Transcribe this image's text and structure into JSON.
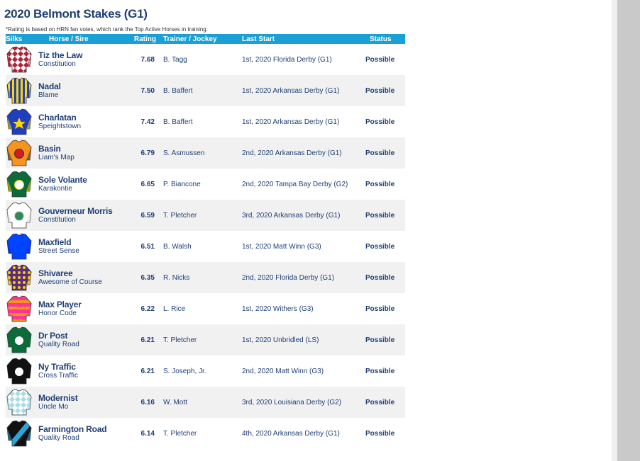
{
  "page": {
    "title": "2020 Belmont Stakes (G1)",
    "footnote": "*Rating is based on HRN fan votes, which rank the Top Active Horses in training."
  },
  "table": {
    "headers": [
      "Silks",
      "Horse / Sire",
      "Rating",
      "Trainer / Jockey",
      "Last Start",
      "Status"
    ],
    "rows": [
      {
        "horse": "Tiz the Law",
        "sire": "Constitution",
        "rating": "7.68",
        "trainer": "B. Tagg",
        "last_start": "1st, 2020 Florida Derby (G1)",
        "status": "Possible",
        "silk": {
          "pattern": "diamonds",
          "base": "#ffffff",
          "accent": "#b22234",
          "trim": "#b22234"
        }
      },
      {
        "horse": "Nadal",
        "sire": "Blame",
        "rating": "7.50",
        "trainer": "B. Baffert",
        "last_start": "1st, 2020 Arkansas Derby (G1)",
        "status": "Possible",
        "silk": {
          "pattern": "stripes",
          "base": "#1f3fbf",
          "accent": "#ffd700",
          "trim": "#1f3fbf"
        }
      },
      {
        "horse": "Charlatan",
        "sire": "Speightstown",
        "rating": "7.42",
        "trainer": "B. Baffert",
        "last_start": "1st, 2020 Arkansas Derby (G1)",
        "status": "Possible",
        "silk": {
          "pattern": "star",
          "base": "#1f3fbf",
          "accent": "#ffd700",
          "trim": "#ffd700"
        }
      },
      {
        "horse": "Basin",
        "sire": "Liam's Map",
        "rating": "6.79",
        "trainer": "S. Asmussen",
        "last_start": "2nd, 2020 Arkansas Derby (G1)",
        "status": "Possible",
        "silk": {
          "pattern": "emblem",
          "base": "#f7941d",
          "accent": "#d71920",
          "trim": "#333333"
        }
      },
      {
        "horse": "Sole Volante",
        "sire": "Karakontie",
        "rating": "6.65",
        "trainer": "P. Biancone",
        "last_start": "2nd, 2020 Tampa Bay Derby (G2)",
        "status": "Possible",
        "silk": {
          "pattern": "emblem",
          "base": "#0d6b3a",
          "accent": "#ffffff",
          "trim": "#f5d000"
        }
      },
      {
        "horse": "Gouverneur Morris",
        "sire": "Constitution",
        "rating": "6.59",
        "trainer": "T. Pletcher",
        "last_start": "3rd, 2020 Arkansas Derby (G1)",
        "status": "Possible",
        "silk": {
          "pattern": "emblem",
          "base": "#ffffff",
          "accent": "#2e8b57",
          "trim": "#dddddd"
        }
      },
      {
        "horse": "Maxfield",
        "sire": "Street Sense",
        "rating": "6.51",
        "trainer": "B. Walsh",
        "last_start": "1st, 2020 Matt Winn (G3)",
        "status": "Possible",
        "silk": {
          "pattern": "solid",
          "base": "#0044ff",
          "accent": "#0044ff",
          "trim": "#0033cc"
        }
      },
      {
        "horse": "Shivaree",
        "sire": "Awesome of Course",
        "rating": "6.35",
        "trainer": "R. Nicks",
        "last_start": "2nd, 2020 Florida Derby (G1)",
        "status": "Possible",
        "silk": {
          "pattern": "dots",
          "base": "#5b2a86",
          "accent": "#f5d000",
          "trim": "#f5d000"
        }
      },
      {
        "horse": "Max Player",
        "sire": "Honor Code",
        "rating": "6.22",
        "trainer": "L. Rice",
        "last_start": "1st, 2020 Withers (G3)",
        "status": "Possible",
        "silk": {
          "pattern": "hoops",
          "base": "#ff3399",
          "accent": "#f7941d",
          "trim": "#ff3399"
        }
      },
      {
        "horse": "Dr Post",
        "sire": "Quality Road",
        "rating": "6.21",
        "trainer": "T. Pletcher",
        "last_start": "1st, 2020 Unbridled (LS)",
        "status": "Possible",
        "silk": {
          "pattern": "emblem",
          "base": "#0d6b3a",
          "accent": "#ffffff",
          "trim": "#0d6b3a"
        }
      },
      {
        "horse": "Ny Traffic",
        "sire": "Cross Traffic",
        "rating": "6.21",
        "trainer": "S. Joseph, Jr.",
        "last_start": "2nd, 2020 Matt Winn (G3)",
        "status": "Possible",
        "silk": {
          "pattern": "emblem",
          "base": "#111111",
          "accent": "#ffffff",
          "trim": "#111111"
        }
      },
      {
        "horse": "Modernist",
        "sire": "Uncle Mo",
        "rating": "6.16",
        "trainer": "W. Mott",
        "last_start": "3rd, 2020 Louisiana Derby (G2)",
        "status": "Possible",
        "silk": {
          "pattern": "diamonds",
          "base": "#a8dce8",
          "accent": "#ffffff",
          "trim": "#a8dce8"
        }
      },
      {
        "horse": "Farmington Road",
        "sire": "Quality Road",
        "rating": "6.14",
        "trainer": "T. Pletcher",
        "last_start": "4th, 2020 Arkansas Derby (G1)",
        "status": "Possible",
        "silk": {
          "pattern": "sash",
          "base": "#111111",
          "accent": "#2aa7d8",
          "trim": "#2aa7d8"
        }
      }
    ]
  }
}
